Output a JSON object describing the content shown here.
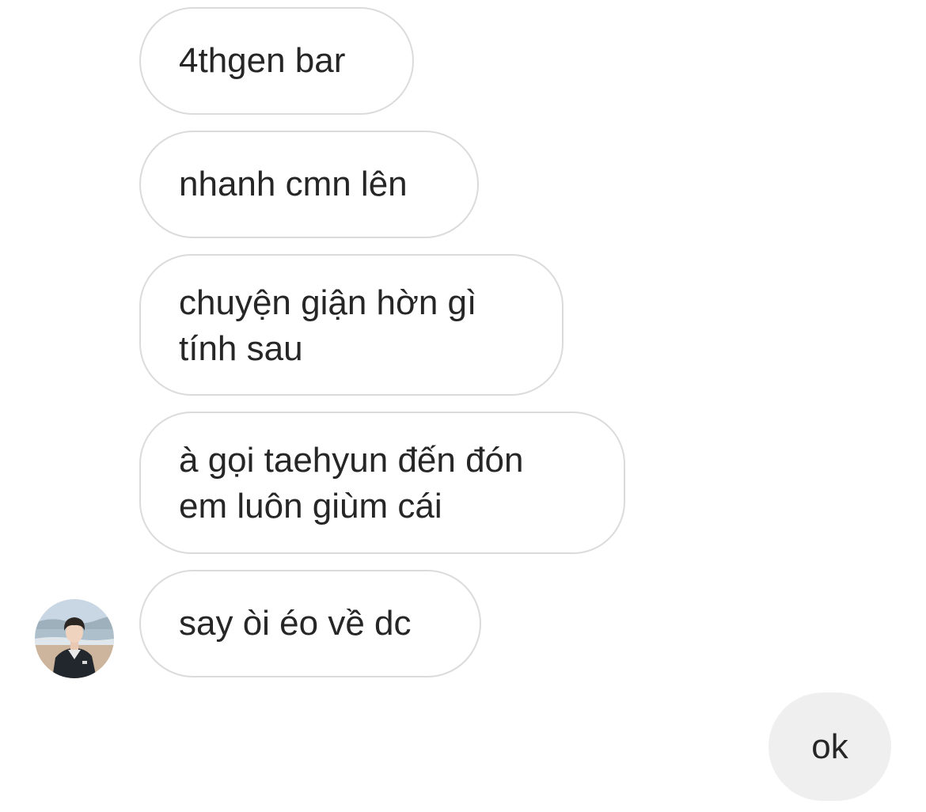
{
  "conversation": {
    "incoming_messages": [
      {
        "text": "4thgen bar"
      },
      {
        "text": "nhanh cmn lên"
      },
      {
        "text": "chuyện giận hờn gì\ntính sau"
      },
      {
        "text": "à gọi taehyun đến đón\nem luôn giùm cái"
      },
      {
        "text": "say òi éo về dc"
      }
    ],
    "outgoing_messages": [
      {
        "text": "ok"
      }
    ],
    "sender_avatar": {
      "icon": "contact-avatar-photo"
    }
  },
  "colors": {
    "incoming_border": "#dbdbdb",
    "incoming_background": "#ffffff",
    "outgoing_background": "#efefef",
    "text": "#262626"
  }
}
